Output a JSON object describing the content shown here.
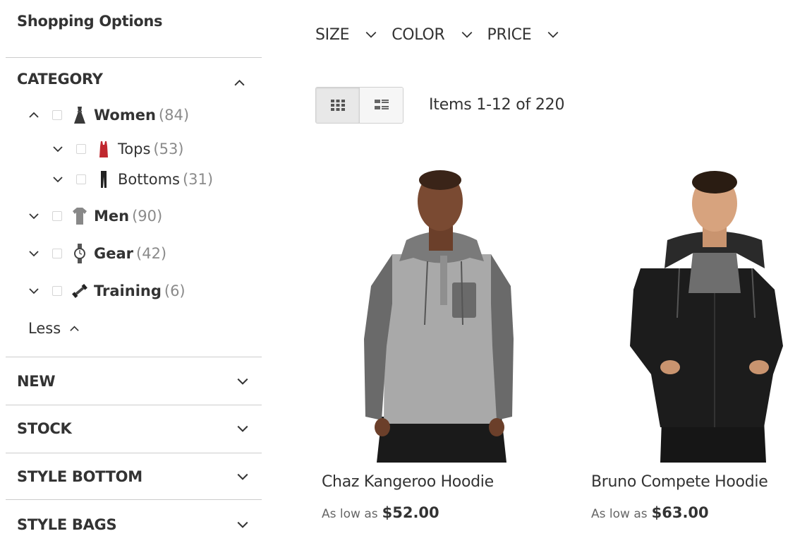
{
  "sidebar": {
    "title": "Shopping Options",
    "category": {
      "header": "CATEGORY",
      "items": [
        {
          "name": "Women",
          "count": "(84)",
          "icon": "dress-icon",
          "expanded": true
        },
        {
          "name": "Tops",
          "count": "(53)",
          "icon": "top-icon",
          "expanded": false
        },
        {
          "name": "Bottoms",
          "count": "(31)",
          "icon": "pants-icon",
          "expanded": false
        },
        {
          "name": "Men",
          "count": "(90)",
          "icon": "tshirt-icon",
          "expanded": false
        },
        {
          "name": "Gear",
          "count": "(42)",
          "icon": "watch-icon",
          "expanded": false
        },
        {
          "name": "Training",
          "count": "(6)",
          "icon": "dumbbell-icon",
          "expanded": false
        }
      ],
      "less_label": "Less"
    },
    "filters": [
      {
        "label": "NEW"
      },
      {
        "label": "STOCK"
      },
      {
        "label": "STYLE BOTTOM"
      },
      {
        "label": "STYLE BAGS"
      }
    ]
  },
  "toolbar": {
    "filters": [
      {
        "label": "SIZE"
      },
      {
        "label": "COLOR"
      },
      {
        "label": "PRICE"
      }
    ],
    "view_modes": [
      {
        "name": "grid",
        "active": true
      },
      {
        "name": "list",
        "active": false
      }
    ],
    "items_count": "Items 1-12 of 220"
  },
  "products": [
    {
      "name": "Chaz Kangeroo Hoodie",
      "as_low_as": "As low as",
      "price": "$52.00",
      "color": "gray"
    },
    {
      "name": "Bruno Compete Hoodie",
      "as_low_as": "As low as",
      "price": "$63.00",
      "color": "black"
    }
  ],
  "colors": {
    "text": "#333333",
    "muted": "#8a8a8a",
    "divider": "#cccccc",
    "accent_gray_hoodie": "#9a9a9a",
    "accent_black_hoodie": "#1c1c1c"
  }
}
